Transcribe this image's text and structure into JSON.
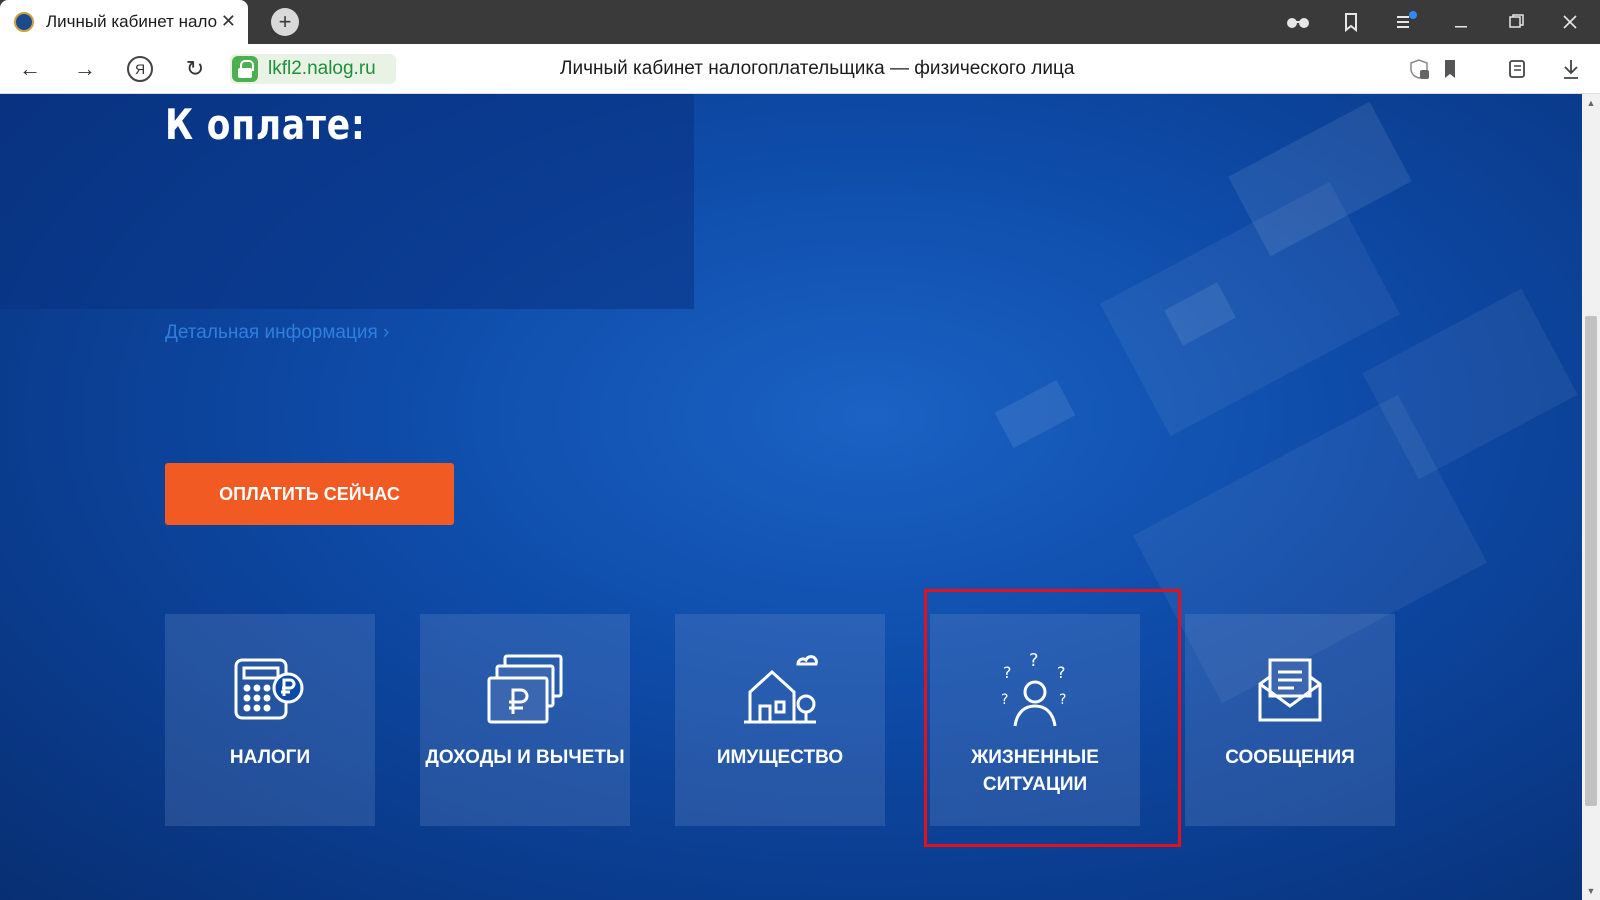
{
  "browser": {
    "tab_title": "Личный кабинет налогоплательщика",
    "tab_close": "✕",
    "new_tab": "+",
    "url": "lkfl2.nalog.ru",
    "page_title": "Личный кабинет налогоплательщика — физического лица",
    "nav": {
      "back": "←",
      "forward": "→",
      "ya": "Я",
      "reload": "↻"
    },
    "icons": [
      "reader-mode-icon",
      "bookmarks-icon",
      "menu-icon",
      "minimize-icon",
      "maximize-icon",
      "close-icon"
    ]
  },
  "page": {
    "heading": "К оплате:",
    "detail_link": "Детальная информация  ›",
    "pay_button": "ОПЛАТИТЬ СЕЙЧАС",
    "accent_color": "#f25a23",
    "cards": [
      {
        "label": "НАЛОГИ",
        "icon": "calculator-ruble-icon"
      },
      {
        "label": "ДОХОДЫ И ВЫЧЕТЫ",
        "icon": "banknotes-icon"
      },
      {
        "label": "ИМУЩЕСТВО",
        "icon": "house-icon"
      },
      {
        "label": "ЖИЗНЕННЫЕ СИТУАЦИИ",
        "icon": "person-questions-icon"
      },
      {
        "label": "СООБЩЕНИЯ",
        "icon": "envelope-icon"
      }
    ]
  }
}
